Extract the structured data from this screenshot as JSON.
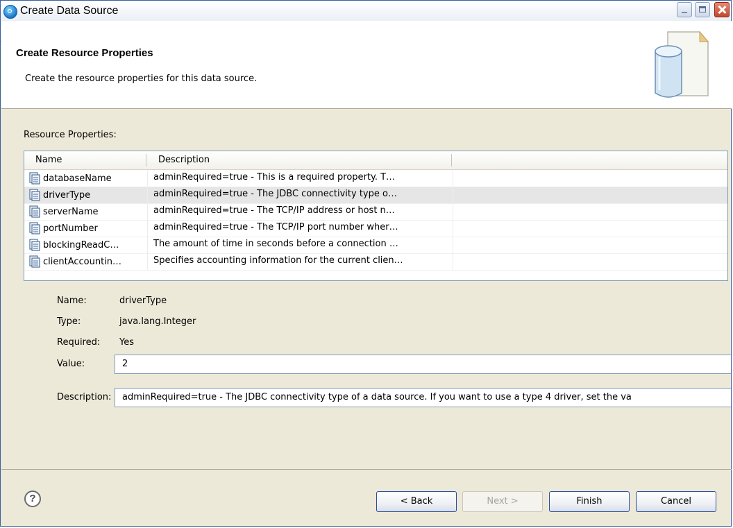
{
  "window": {
    "title": "Create Data Source"
  },
  "header": {
    "title": "Create Resource Properties",
    "subtitle": "Create the resource properties for this data source."
  },
  "table": {
    "label": "Resource Properties:",
    "columns": [
      "Name",
      "Description"
    ],
    "rows": [
      {
        "name": "databaseName",
        "description": "adminRequired=true - This is a required property. T…"
      },
      {
        "name": "driverType",
        "description": "adminRequired=true - The JDBC connectivity type o…"
      },
      {
        "name": "serverName",
        "description": "adminRequired=true - The TCP/IP address or host n…"
      },
      {
        "name": "portNumber",
        "description": "adminRequired=true - The TCP/IP port number wher…"
      },
      {
        "name": "blockingReadC…",
        "description": "The amount of time in seconds before a connection …"
      },
      {
        "name": "clientAccountin…",
        "description": "Specifies accounting information for the current clien…"
      }
    ],
    "selected_index": 1
  },
  "details": {
    "name_label": "Name:",
    "name_value": "driverType",
    "type_label": "Type:",
    "type_value": "java.lang.Integer",
    "required_label": "Required:",
    "required_value": "Yes",
    "value_label": "Value:",
    "value_value": "2",
    "description_label": "Description:",
    "description_value": "adminRequired=true - The JDBC connectivity type of a data source. If you want to use a type 4 driver, set the va"
  },
  "footer": {
    "help_label": "?",
    "back_label": "< Back",
    "next_label": "Next >",
    "finish_label": "Finish",
    "cancel_label": "Cancel"
  },
  "icons": {
    "app": "eclipse-icon",
    "property": "property-icon",
    "banner": "database-icon",
    "help": "help-icon"
  }
}
